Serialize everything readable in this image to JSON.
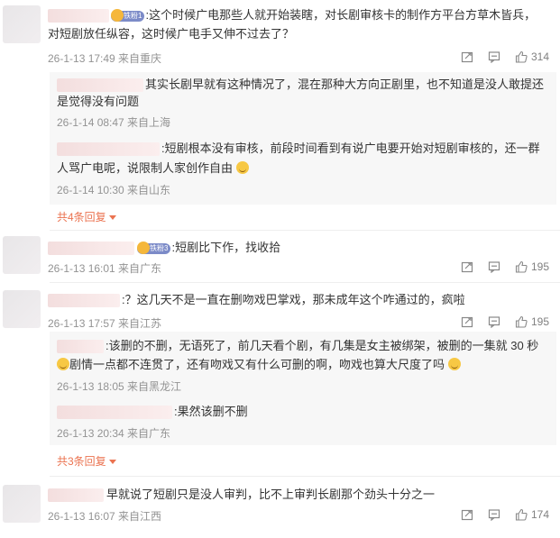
{
  "comments": [
    {
      "fan_badge": "铁粉1",
      "line1": ":这个时候广电那些人就开始装瞎，对长剧审核卡的制作方平台方草木皆兵，",
      "line2": "对短剧放任纵容，这时候广电手又伸不过去了？",
      "meta": "26-1-13 17:49 来自重庆",
      "like_count": "314",
      "replies": [
        {
          "line1": "其实长剧早就有这种情况了，混在那种大方向正剧里，也不知道是没人敢提还",
          "line2": "是觉得没有问题",
          "meta": "26-1-14 08:47 来自上海"
        },
        {
          "line1": ":短剧根本没有审核，前段时间看到有说广电要开始对短剧审核的，还一群",
          "line2": "人骂广电呢，说限制人家创作自由",
          "meta": "26-1-14 10:30 来自山东"
        }
      ],
      "more_replies": "共4条回复"
    },
    {
      "fan_badge": "铁粉3",
      "line1": ":短剧比下作，找收拾",
      "meta": "26-1-13 16:01 来自广东",
      "like_count": "195"
    },
    {
      "line1": ":？这几天不是一直在删吻戏巴掌戏，那未成年这个咋通过的，疯啦",
      "meta": "26-1-13 17:57 来自江苏",
      "like_count": "195",
      "replies": [
        {
          "line1": ":该删的不删，无语死了，前几天看个剧，有几集是女主被绑架，被删的一集就 30 秒",
          "line2": "剧情一点都不连贯了，还有吻戏又有什么可删的啊，吻戏也算大尺度了吗",
          "meta": "26-1-13 18:05 来自黑龙江"
        },
        {
          "line1": ":果然该删不删",
          "meta": "26-1-13 20:34 来自广东"
        }
      ],
      "more_replies": "共3条回复"
    },
    {
      "line1": "早就说了短剧只是没人审判，比不上审判长剧那个劲头十分之一",
      "meta": "26-1-13 16:07 来自江西",
      "like_count": "174"
    }
  ],
  "icons": {
    "share": "share-icon",
    "comment": "comment-icon",
    "like": "thumbs-up-icon",
    "emoji": "grin-sweat-emoji"
  },
  "colors": {
    "accent": "#eb7350",
    "meta": "#939393",
    "reply_bg": "#f7f7f7"
  }
}
